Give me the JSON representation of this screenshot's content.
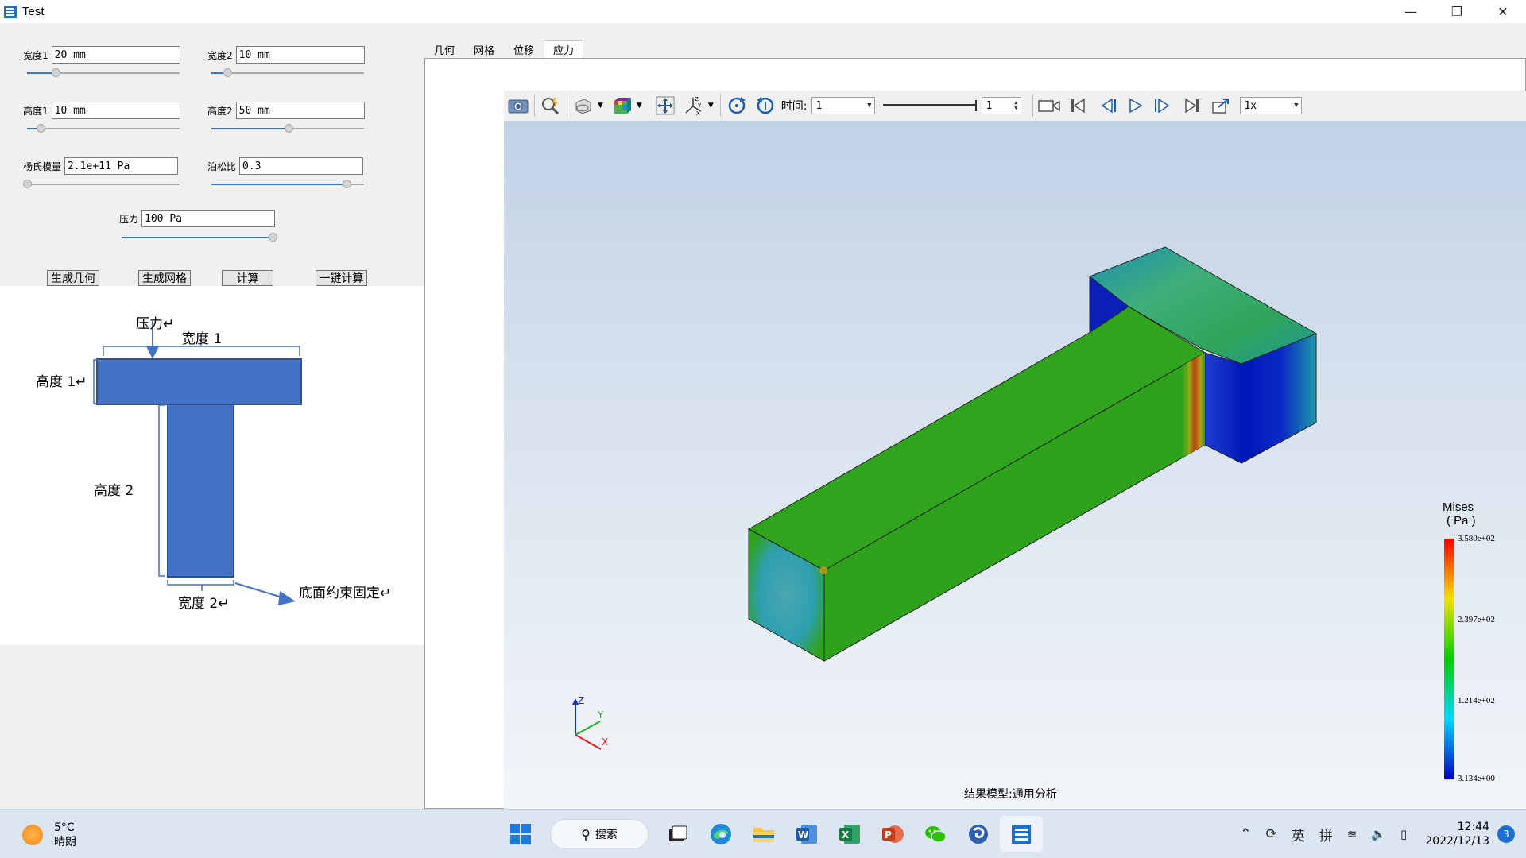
{
  "window": {
    "title": "Test"
  },
  "params": {
    "width1": {
      "label": "宽度1",
      "value": "20 mm",
      "slider": 0.2
    },
    "width2": {
      "label": "宽度2",
      "value": "10 mm",
      "slider": 0.1
    },
    "height1": {
      "label": "高度1",
      "value": "10 mm",
      "slider": 0.1
    },
    "height2": {
      "label": "高度2",
      "value": "50 mm",
      "slider": 0.5
    },
    "youngs": {
      "label": "杨氏模量",
      "value": "2.1e+11 Pa",
      "slider": 0.0
    },
    "poisson": {
      "label": "泊松比",
      "value": "0.3",
      "slider": 0.88
    },
    "pressure": {
      "label": "压力",
      "value": "100 Pa",
      "slider": 1.0
    }
  },
  "buttons": {
    "gen_geometry": "生成几何",
    "gen_mesh": "生成网格",
    "compute": "计算",
    "one_click": "一键计算"
  },
  "diagram": {
    "pressure": "压力↵",
    "width1": "宽度 1",
    "height1": "高度 1↵",
    "height2": "高度 2",
    "width2": "宽度 2↵",
    "bottom_fixed": "底面约束固定↵"
  },
  "tabs": [
    "几何",
    "网格",
    "位移",
    "应力"
  ],
  "active_tab": 3,
  "toolbar": {
    "time_label": "时间:",
    "time_value": "1",
    "frame_value": "1",
    "speed_value": "1x"
  },
  "legend": {
    "title_line1": "Mises",
    "title_line2": "( Pa )",
    "max": "3.580e+02",
    "v2": "2.397e+02",
    "v1": "1.214e+02",
    "min": "3.134e+00"
  },
  "axes": {
    "x": "X",
    "y": "Y",
    "z": "Z"
  },
  "status": "结果模型:通用分析",
  "taskbar": {
    "temperature": "5°C",
    "weather": "晴朗",
    "search": "搜索",
    "ime1": "英",
    "ime2": "拼",
    "time": "12:44",
    "date": "2022/12/13",
    "notifications": "3"
  },
  "colors": {
    "accent": "#3c78c8",
    "diagram_blue": "#4472c4",
    "mesh_green": "#2ea21a"
  }
}
